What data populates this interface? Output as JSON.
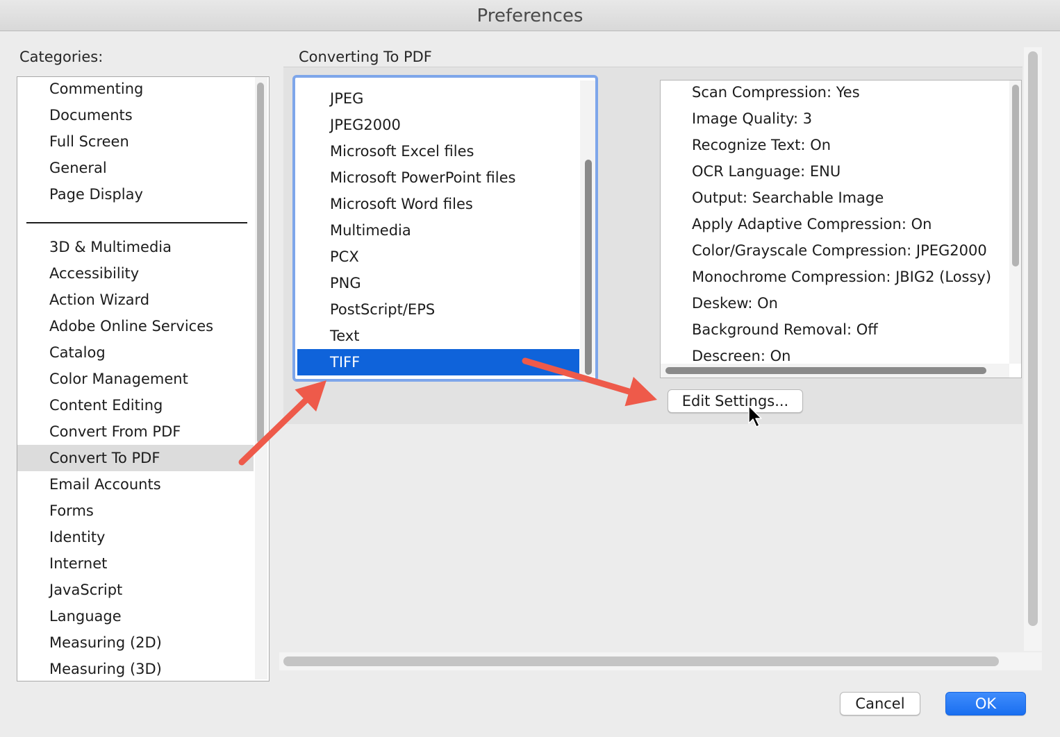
{
  "window": {
    "title": "Preferences"
  },
  "categories": {
    "label": "Categories:",
    "top_items": [
      "Commenting",
      "Documents",
      "Full Screen",
      "General",
      "Page Display"
    ],
    "items": [
      "3D & Multimedia",
      "Accessibility",
      "Action Wizard",
      "Adobe Online Services",
      "Catalog",
      "Color Management",
      "Content Editing",
      "Convert From PDF",
      "Convert To PDF",
      "Email Accounts",
      "Forms",
      "Identity",
      "Internet",
      "JavaScript",
      "Language",
      "Measuring (2D)",
      "Measuring (3D)"
    ],
    "selected": "Convert To PDF"
  },
  "section": {
    "title": "Converting To PDF"
  },
  "formats": {
    "items": [
      "JPEG",
      "JPEG2000",
      "Microsoft Excel files",
      "Microsoft PowerPoint files",
      "Microsoft Word files",
      "Multimedia",
      "PCX",
      "PNG",
      "PostScript/EPS",
      "Text",
      "TIFF"
    ],
    "selected": "TIFF"
  },
  "settings": {
    "items": [
      "Scan Compression: Yes",
      "Image Quality: 3",
      "Recognize Text: On",
      "OCR Language: ENU",
      "Output: Searchable Image",
      "Apply Adaptive Compression: On",
      "Color/Grayscale Compression: JPEG2000",
      "Monochrome Compression: JBIG2 (Lossy)",
      "Deskew: On",
      "Background Removal: Off",
      "Descreen: On"
    ]
  },
  "buttons": {
    "edit_settings": "Edit Settings...",
    "cancel": "Cancel",
    "ok": "OK"
  },
  "annotations": {
    "arrow_color": "#ee5a4a"
  },
  "colors": {
    "selection_blue": "#0f63da",
    "focus_ring": "#7ea6ea"
  }
}
